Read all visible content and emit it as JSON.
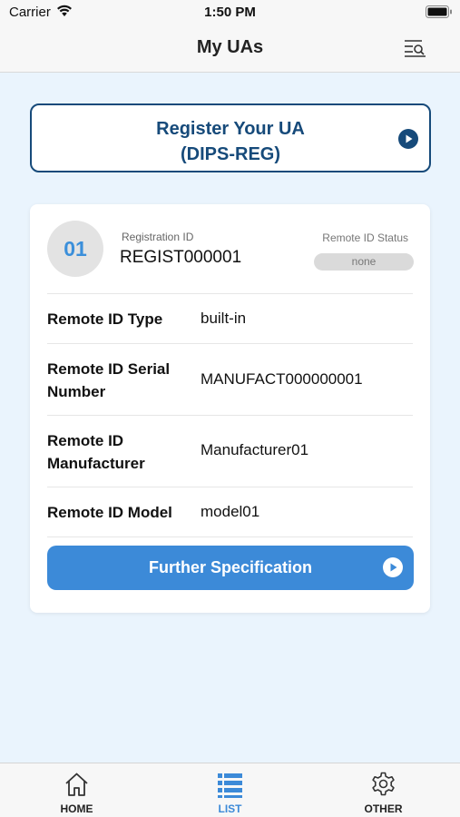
{
  "status_bar": {
    "carrier": "Carrier",
    "time": "1:50 PM",
    "icons": [
      "wifi-icon",
      "battery-icon"
    ]
  },
  "nav": {
    "title": "My UAs",
    "right_icon": "list-search-icon"
  },
  "register_button": {
    "line1": "Register Your UA",
    "line2": "(DIPS-REG)",
    "icon": "play-circle-icon"
  },
  "card": {
    "number": "01",
    "registration_id_label": "Registration ID",
    "registration_id_value": "REGIST000001",
    "remote_id_status_label": "Remote ID Status",
    "remote_id_status_value": "none",
    "rows": [
      {
        "label": "Remote ID Type",
        "value": "built-in"
      },
      {
        "label": "Remote ID Serial Number",
        "value": "MANUFACT000000001"
      },
      {
        "label": "Remote ID Manufacturer",
        "value": "Manufacturer01"
      },
      {
        "label": "Remote ID Model",
        "value": "model01"
      }
    ],
    "further_button": "Further Specification"
  },
  "tabs": [
    {
      "label": "HOME",
      "icon": "home-icon",
      "active": false
    },
    {
      "label": "LIST",
      "icon": "list-icon",
      "active": true
    },
    {
      "label": "OTHER",
      "icon": "gear-icon",
      "active": false
    }
  ],
  "colors": {
    "accent": "#3c8ad8",
    "navy": "#164a7a",
    "background": "#eaf4fd"
  }
}
